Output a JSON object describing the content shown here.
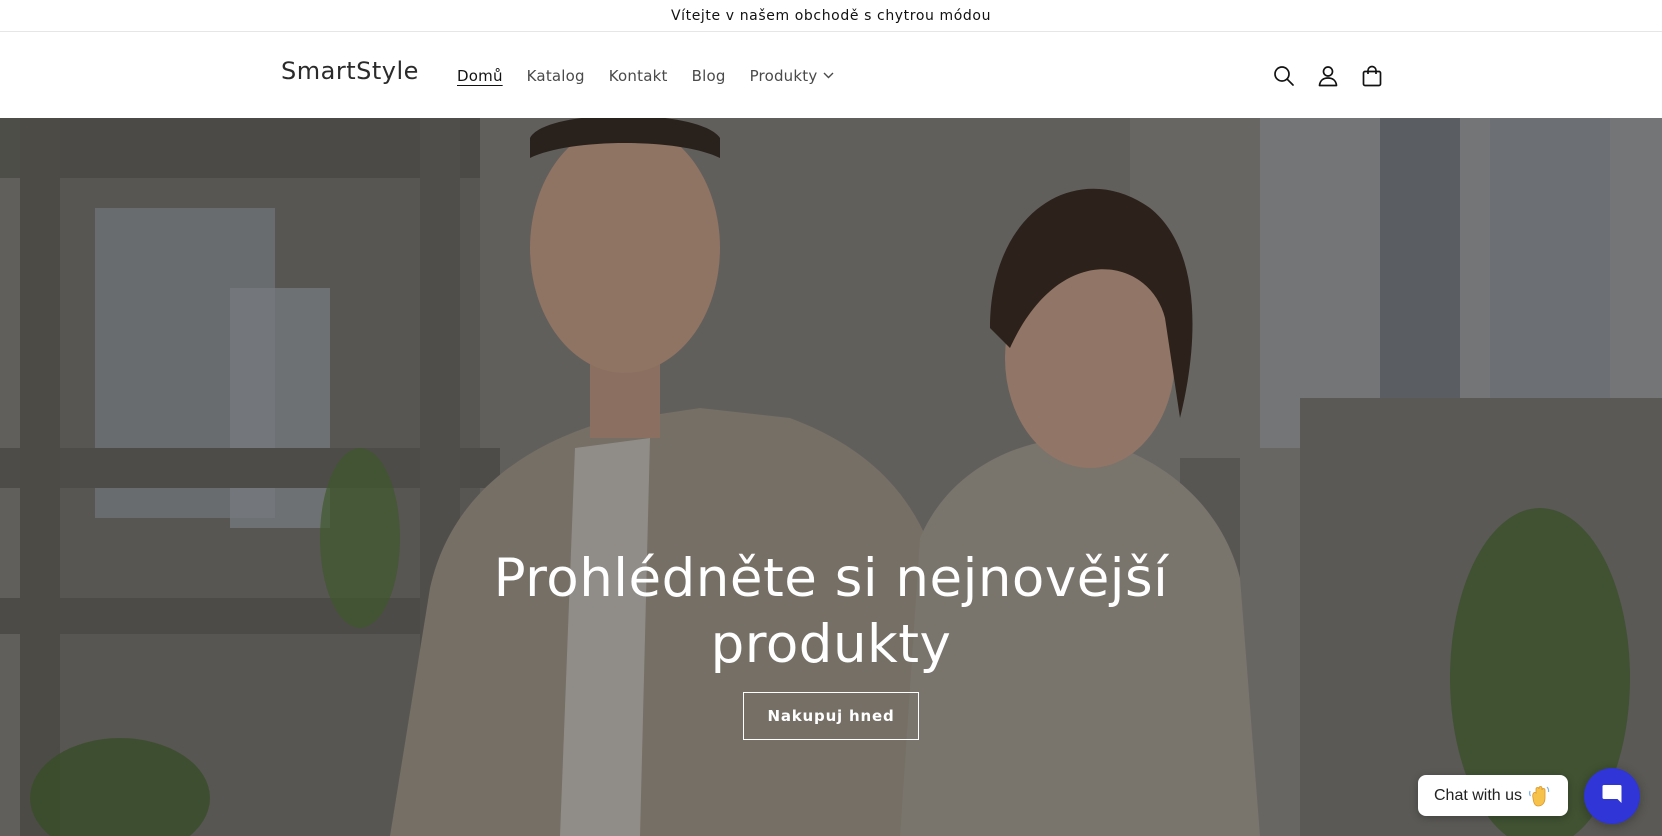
{
  "announcement": {
    "text": "Vítejte v našem obchodě s chytrou módou"
  },
  "header": {
    "logo": "SmartStyle",
    "nav": [
      {
        "label": "Domů",
        "active": true
      },
      {
        "label": "Katalog",
        "active": false
      },
      {
        "label": "Kontakt",
        "active": false
      },
      {
        "label": "Blog",
        "active": false
      },
      {
        "label": "Produkty",
        "active": false,
        "has_dropdown": true
      }
    ],
    "icons": [
      "search-icon",
      "account-icon",
      "cart-icon"
    ]
  },
  "hero": {
    "title": "Prohlédněte si nejnovější produkty",
    "cta_label": "Nakupuj hned"
  },
  "chat": {
    "bubble_label": "Chat with us",
    "emoji": "waving-hand",
    "launcher_icon": "chat-icon",
    "accent": "#2f35d6"
  },
  "colors": {
    "text": "#121212",
    "background": "#ffffff"
  }
}
